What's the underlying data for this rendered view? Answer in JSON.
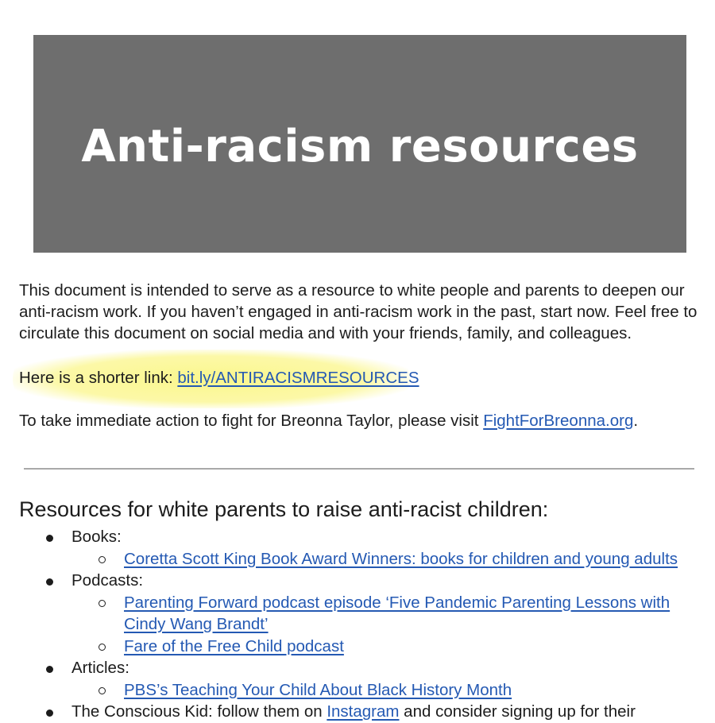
{
  "banner": {
    "title": "Anti-racism resources"
  },
  "intro": {
    "text": "This document is intended to serve as a resource to white people and parents to deepen our anti-racism work. If you haven’t engaged in anti-racism work in the past, start now. Feel free to circulate this document on social media and with your friends, family, and colleagues."
  },
  "short_link": {
    "prefix": "Here is a shorter link: ",
    "link_text": "bit.ly/ANTIRACISMRESOURCES"
  },
  "action": {
    "prefix": "To take immediate action to fight for Breonna Taylor, please visit ",
    "link_text": "FightForBreonna.org",
    "suffix": "."
  },
  "section": {
    "heading": "Resources for white parents to raise anti-racist children:",
    "categories": [
      {
        "label": "Books:",
        "items": [
          "Coretta Scott King Book Award Winners: books for children and young adults"
        ]
      },
      {
        "label": "Podcasts:",
        "items": [
          "Parenting Forward podcast episode ‘Five Pandemic Parenting Lessons with Cindy Wang Brandt’",
          "Fare of the Free Child podcast"
        ]
      },
      {
        "label": "Articles:",
        "items": [
          "PBS’s Teaching Your Child About Black History Month"
        ]
      },
      {
        "label_prefix": "The Conscious Kid: follow them on ",
        "label_link": "Instagram",
        "label_suffix": " and consider signing up for their"
      }
    ]
  },
  "colors": {
    "banner_bg": "#6e6e6e",
    "link": "#2459b3",
    "highlight": "#faf578"
  }
}
